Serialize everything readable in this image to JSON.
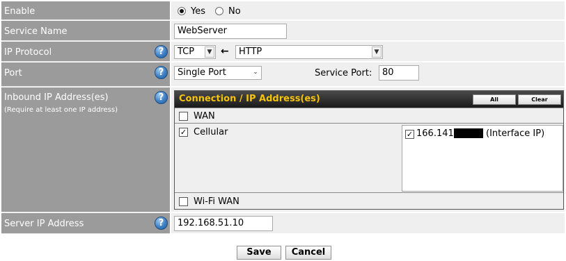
{
  "enable": {
    "label": "Enable",
    "options": [
      {
        "label": "Yes",
        "selected": true
      },
      {
        "label": "No",
        "selected": false
      }
    ]
  },
  "service_name": {
    "label": "Service Name",
    "value": "WebServer"
  },
  "ip_protocol": {
    "label": "IP Protocol",
    "protocol": "TCP",
    "arrow": "←",
    "preset": "HTTP"
  },
  "port": {
    "label": "Port",
    "type": "Single Port",
    "service_port_label": "Service Port:",
    "service_port_value": "80"
  },
  "inbound": {
    "label": "Inbound IP Address(es)",
    "sublabel": "(Require at least one IP address)",
    "header_title": "Connection / IP Address(es)",
    "all_button": "All",
    "clear_button": "Clear",
    "connections": [
      {
        "name": "WAN",
        "checked": false
      },
      {
        "name": "Cellular",
        "checked": true,
        "ip_prefix": "166.141.",
        "ip_suffix": "(Interface IP)",
        "ip_checked": true
      },
      {
        "name": "Wi-Fi WAN",
        "checked": false
      }
    ]
  },
  "server_ip": {
    "label": "Server IP Address",
    "value": "192.168.51.10"
  },
  "help_symbol": "?",
  "actions": {
    "save": "Save",
    "cancel": "Cancel"
  },
  "colors": {
    "label_bg": "#9b9b9b",
    "value_bg": "#efefef",
    "header_text": "#f5c40b",
    "help_icon": "#3e7fc2"
  }
}
